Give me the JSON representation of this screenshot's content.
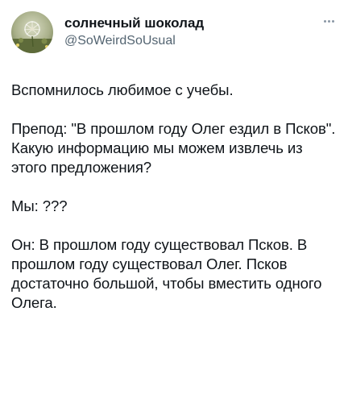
{
  "author": {
    "display_name": "солнечный шоколад",
    "handle": "@SoWeirdSoUsual",
    "avatar_icon": "avatar-dandelion-photo"
  },
  "more_icon": "more-dots-icon",
  "colors": {
    "text": "#0f1419",
    "secondary": "#536471",
    "background": "#ffffff"
  },
  "tweet": {
    "paragraphs": [
      "Вспомнилось любимое с учебы.",
      "Препод: \"В прошлом году Олег ездил в Псков\". Какую информацию мы можем извлечь из этого предложения?",
      "Мы: ???",
      "Он: В прошлом году существовал Псков. В прошлом году существовал Олег. Псков достаточно большой, чтобы вместить одного Олега."
    ]
  }
}
